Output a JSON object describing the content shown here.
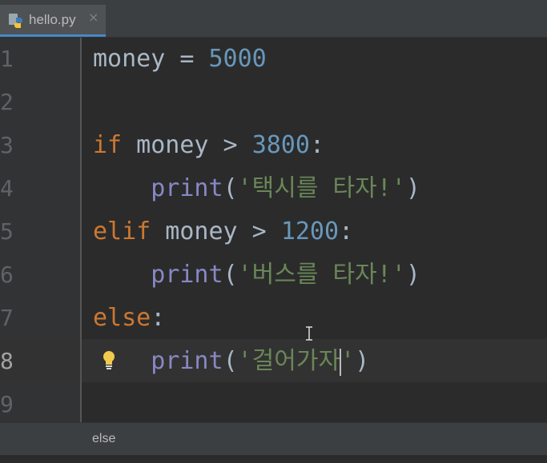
{
  "tab": {
    "filename": "hello.py",
    "close_glyph": "×",
    "icon": "python-file-icon"
  },
  "line_numbers": [
    "1",
    "2",
    "3",
    "4",
    "5",
    "6",
    "7",
    "8",
    "9"
  ],
  "current_line": "8",
  "code": {
    "l1": {
      "var": "money",
      "op": " = ",
      "num": "5000"
    },
    "l3": {
      "kw": "if",
      "mid": " money > ",
      "num": "3800",
      "colon": ":"
    },
    "l4": {
      "indent": "    ",
      "fn": "print",
      "open": "(",
      "str": "'택시를 타자!'",
      "close": ")"
    },
    "l5": {
      "kw": "elif",
      "mid": " money > ",
      "num": "1200",
      "colon": ":"
    },
    "l6": {
      "indent": "    ",
      "fn": "print",
      "open": "(",
      "str": "'버스를 타자!'",
      "close": ")"
    },
    "l7": {
      "kw": "else",
      "colon": ":"
    },
    "l8": {
      "indent": "    ",
      "fn": "print",
      "open": "(",
      "str_a": "'걸어가자",
      "str_b": "'",
      "close": ")"
    }
  },
  "statusbar": {
    "breadcrumb": "else"
  },
  "colors": {
    "keyword": "#cc7832",
    "number": "#6897bb",
    "builtin": "#8888c6",
    "string": "#6a8759",
    "text": "#a9b7c6"
  }
}
